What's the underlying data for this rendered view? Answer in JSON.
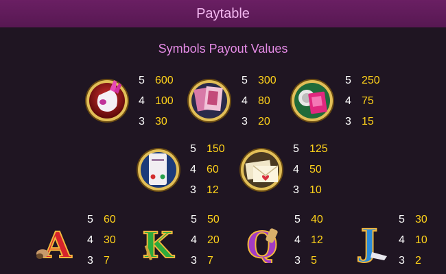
{
  "header": {
    "title": "Paytable"
  },
  "subtitle": "Symbols Payout Values",
  "symbols": [
    {
      "icon": "vibrator-icon",
      "pays": [
        {
          "count": "5",
          "value": "600"
        },
        {
          "count": "4",
          "value": "100"
        },
        {
          "count": "3",
          "value": "30"
        }
      ]
    },
    {
      "icon": "magazine-icon",
      "pays": [
        {
          "count": "5",
          "value": "300"
        },
        {
          "count": "4",
          "value": "80"
        },
        {
          "count": "3",
          "value": "20"
        }
      ]
    },
    {
      "icon": "condom-icon",
      "pays": [
        {
          "count": "5",
          "value": "250"
        },
        {
          "count": "4",
          "value": "75"
        },
        {
          "count": "3",
          "value": "15"
        }
      ]
    },
    {
      "icon": "phone-call-icon",
      "pays": [
        {
          "count": "5",
          "value": "150"
        },
        {
          "count": "4",
          "value": "60"
        },
        {
          "count": "3",
          "value": "12"
        }
      ]
    },
    {
      "icon": "love-letter-icon",
      "pays": [
        {
          "count": "5",
          "value": "125"
        },
        {
          "count": "4",
          "value": "50"
        },
        {
          "count": "3",
          "value": "10"
        }
      ]
    },
    {
      "icon": "letter-a-icon",
      "letter": "A",
      "pays": [
        {
          "count": "5",
          "value": "60"
        },
        {
          "count": "4",
          "value": "30"
        },
        {
          "count": "3",
          "value": "7"
        }
      ]
    },
    {
      "icon": "letter-k-icon",
      "letter": "K",
      "pays": [
        {
          "count": "5",
          "value": "50"
        },
        {
          "count": "4",
          "value": "20"
        },
        {
          "count": "3",
          "value": "7"
        }
      ]
    },
    {
      "icon": "letter-q-icon",
      "letter": "Q",
      "pays": [
        {
          "count": "5",
          "value": "40"
        },
        {
          "count": "4",
          "value": "12"
        },
        {
          "count": "3",
          "value": "5"
        }
      ]
    },
    {
      "icon": "letter-j-icon",
      "letter": "J",
      "pays": [
        {
          "count": "5",
          "value": "30"
        },
        {
          "count": "4",
          "value": "10"
        },
        {
          "count": "3",
          "value": "2"
        }
      ]
    }
  ],
  "colors": {
    "header_bg": "#5e1a58",
    "background": "#1f1522",
    "title": "#f3b8f0",
    "subtitle": "#e58be6",
    "count": "#ffffff",
    "value": "#ffd21a",
    "gold_ring": "#c9a23a"
  }
}
